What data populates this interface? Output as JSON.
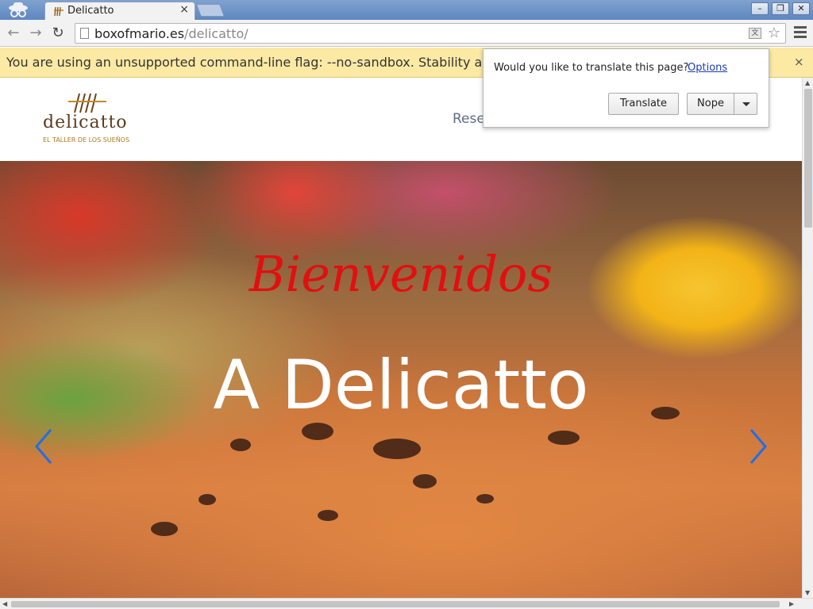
{
  "browser": {
    "tab_title": "Delicatto",
    "tab_close": "×",
    "window_controls": {
      "minimize": "–",
      "maximize": "❐",
      "close": "✕"
    },
    "nav": {
      "back": "←",
      "forward": "→",
      "reload": "↻"
    },
    "url_host": "boxofmario.es",
    "url_path": "/delicatto/",
    "infobar_text": "You are using an unsupported command-line flag: --no-sandbox. Stability and",
    "infobar_close": "×"
  },
  "translate_bubble": {
    "prompt": "Would you like to translate this page?",
    "options_link": "Options",
    "translate_button": "Translate",
    "nope_button": "Nope"
  },
  "site": {
    "logo_word": "delicatto",
    "logo_tagline": "EL TALLER DE LOS SUEÑOS",
    "nav_visible": "Rese",
    "hero_welcome": "Bienvenidos",
    "hero_title": "A Delicatto"
  },
  "colors": {
    "accent_red": "#e01010",
    "infobar_bg": "#fbe9a4",
    "link_blue": "#1a3cb3",
    "arrow_blue": "#1f6fe6"
  },
  "icons": [
    "incognito-icon",
    "page-icon",
    "translate-icon",
    "star-icon",
    "menu-icon",
    "chevron-left-icon",
    "chevron-right-icon"
  ]
}
